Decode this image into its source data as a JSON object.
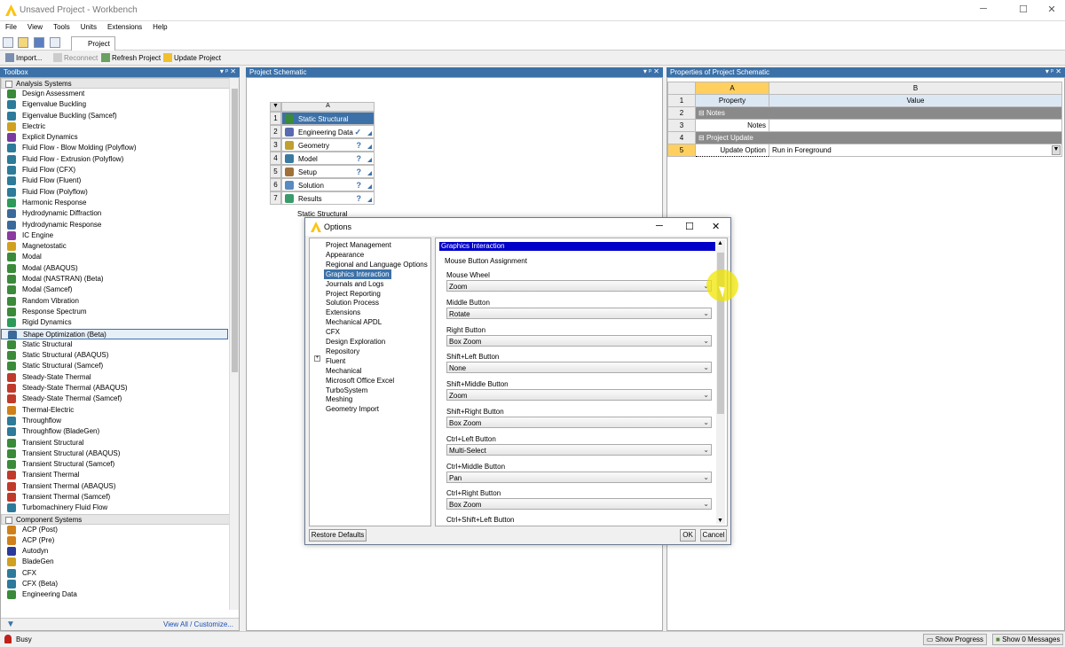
{
  "window": {
    "title": "Unsaved Project - Workbench",
    "min": "─",
    "max": "☐",
    "close": "✕"
  },
  "menu": [
    "File",
    "View",
    "Tools",
    "Units",
    "Extensions",
    "Help"
  ],
  "tabs": {
    "project": "Project"
  },
  "toolbar": {
    "import": "Import...",
    "reconnect": "Reconnect",
    "refresh": "Refresh Project",
    "update": "Update Project"
  },
  "toolbox": {
    "title": "Toolbox",
    "controls": "▾ ᵖ ✕",
    "group1": "Analysis Systems",
    "group2": "Component Systems",
    "footer": "View All / Customize...",
    "items": [
      "Design Assessment",
      "Eigenvalue Buckling",
      "Eigenvalue Buckling (Samcef)",
      "Electric",
      "Explicit Dynamics",
      "Fluid Flow - Blow Molding (Polyflow)",
      "Fluid Flow - Extrusion (Polyflow)",
      "Fluid Flow (CFX)",
      "Fluid Flow (Fluent)",
      "Fluid Flow (Polyflow)",
      "Harmonic Response",
      "Hydrodynamic Diffraction",
      "Hydrodynamic Response",
      "IC Engine",
      "Magnetostatic",
      "Modal",
      "Modal (ABAQUS)",
      "Modal (NASTRAN) (Beta)",
      "Modal (Samcef)",
      "Random Vibration",
      "Response Spectrum",
      "Rigid Dynamics",
      "Shape Optimization (Beta)",
      "Static Structural",
      "Static Structural (ABAQUS)",
      "Static Structural (Samcef)",
      "Steady-State Thermal",
      "Steady-State Thermal (ABAQUS)",
      "Steady-State Thermal (Samcef)",
      "Thermal-Electric",
      "Throughflow",
      "Throughflow (BladeGen)",
      "Transient Structural",
      "Transient Structural (ABAQUS)",
      "Transient Structural (Samcef)",
      "Transient Thermal",
      "Transient Thermal (ABAQUS)",
      "Transient Thermal (Samcef)",
      "Turbomachinery Fluid Flow"
    ],
    "items2": [
      "ACP (Post)",
      "ACP (Pre)",
      "Autodyn",
      "BladeGen",
      "CFX",
      "CFX (Beta)",
      "Engineering Data"
    ]
  },
  "schematic": {
    "title": "Project Schematic",
    "col": "A",
    "rows": [
      {
        "n": "1",
        "label": "Static Structural"
      },
      {
        "n": "2",
        "label": "Engineering Data",
        "status": "✓"
      },
      {
        "n": "3",
        "label": "Geometry",
        "status": "?"
      },
      {
        "n": "4",
        "label": "Model",
        "status": "?"
      },
      {
        "n": "5",
        "label": "Setup",
        "status": "?"
      },
      {
        "n": "6",
        "label": "Solution",
        "status": "?"
      },
      {
        "n": "7",
        "label": "Results",
        "status": "?"
      }
    ],
    "caption": "Static Structural"
  },
  "props": {
    "title": "Properties of Project Schematic",
    "colA": "A",
    "colB": "B",
    "h1": "Property",
    "h2": "Value",
    "r2": "Notes",
    "r3": "Notes",
    "r4": "Project Update",
    "r5a": "Update Option",
    "r5b": "Run in Foreground",
    "rows": [
      "1",
      "2",
      "3",
      "4",
      "5"
    ]
  },
  "status": {
    "busy": "Busy",
    "progress": "Show Progress",
    "messages": "Show 0 Messages"
  },
  "dialog": {
    "title": "Options",
    "tree": [
      "Project Management",
      "Appearance",
      "Regional and Language Options",
      "Graphics Interaction",
      "Journals and Logs",
      "Project Reporting",
      "Solution Process",
      "Extensions",
      "Mechanical APDL",
      "CFX",
      "Design Exploration",
      "Repository",
      "Fluent",
      "Mechanical",
      "Microsoft Office Excel",
      "TurboSystem",
      "Meshing",
      "Geometry Import"
    ],
    "section": "Graphics Interaction",
    "subsection": "Mouse Button Assignment",
    "fields": [
      {
        "label": "Mouse Wheel",
        "value": "Zoom"
      },
      {
        "label": "Middle Button",
        "value": "Rotate"
      },
      {
        "label": "Right Button",
        "value": "Box Zoom"
      },
      {
        "label": "Shift+Left Button",
        "value": "None"
      },
      {
        "label": "Shift+Middle Button",
        "value": "Zoom"
      },
      {
        "label": "Shift+Right Button",
        "value": "Box Zoom"
      },
      {
        "label": "Ctrl+Left Button",
        "value": "Multi-Select"
      },
      {
        "label": "Ctrl+Middle Button",
        "value": "Pan"
      },
      {
        "label": "Ctrl+Right Button",
        "value": "Box Zoom"
      }
    ],
    "lastLabel": "Ctrl+Shift+Left Button",
    "restore": "Restore Defaults",
    "ok": "OK",
    "cancel": "Cancel"
  }
}
